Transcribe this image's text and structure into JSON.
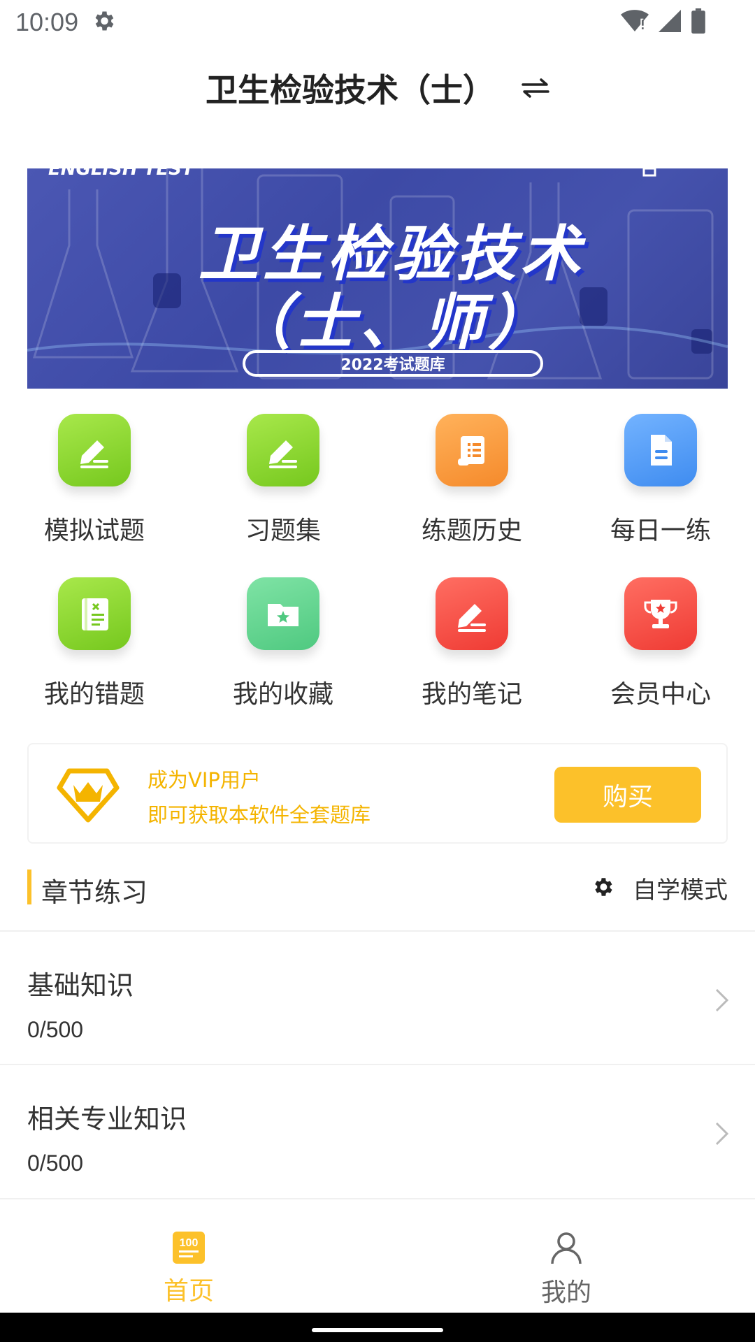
{
  "status_bar": {
    "time": "10:09",
    "icons": [
      "gear-icon",
      "wifi-icon",
      "signal-icon",
      "battery-icon"
    ]
  },
  "header": {
    "title": "卫生检验技术（士）",
    "switch_icon": "swap-arrows-icon"
  },
  "banner": {
    "top_text": "ENGLISH TEST",
    "title_line1": "卫生检验技术",
    "title_line2": "（士、师）",
    "pill_text": "2022考试题库"
  },
  "grid": {
    "items": [
      {
        "label": "模拟试题",
        "icon": "pencil-icon",
        "color": "#8fd733"
      },
      {
        "label": "习题集",
        "icon": "pencil-icon",
        "color": "#8fd733"
      },
      {
        "label": "练题历史",
        "icon": "scroll-icon",
        "color": "#f99c40"
      },
      {
        "label": "每日一练",
        "icon": "document-icon",
        "color": "#58a0f7"
      },
      {
        "label": "我的错题",
        "icon": "notebook-icon",
        "color": "#8fd733"
      },
      {
        "label": "我的收藏",
        "icon": "star-folder-icon",
        "color": "#65d690"
      },
      {
        "label": "我的笔记",
        "icon": "pencil-icon",
        "color": "#f6524a"
      },
      {
        "label": "会员中心",
        "icon": "trophy-icon",
        "color": "#f6524a"
      }
    ]
  },
  "vip": {
    "line1": "成为VIP用户",
    "line2": "即可获取本软件全套题库",
    "buy_label": "购买",
    "accent": "#fcc12a"
  },
  "section": {
    "title": "章节练习",
    "mode_label": "自学模式"
  },
  "chapters": [
    {
      "name": "基础知识",
      "progress": "0/500"
    },
    {
      "name": "相关专业知识",
      "progress": "0/500"
    }
  ],
  "bottom_nav": {
    "home_label": "首页",
    "me_label": "我的"
  }
}
